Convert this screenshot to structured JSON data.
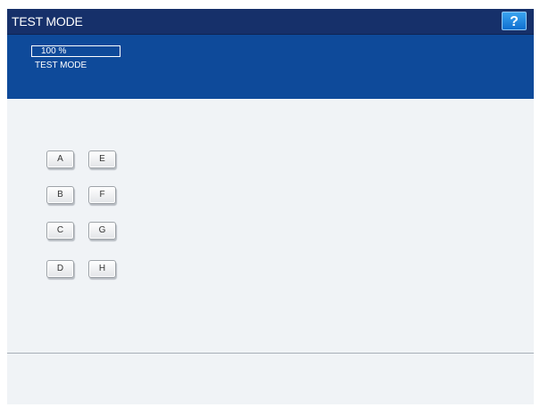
{
  "title_bar": {
    "title": "TEST MODE",
    "help_label": "?"
  },
  "status_panel": {
    "percent": "100 %",
    "mode_text": "TEST MODE"
  },
  "keys": [
    "A",
    "E",
    "B",
    "F",
    "C",
    "G",
    "D",
    "H"
  ],
  "colors": {
    "title_bar": "#16306a",
    "status_panel": "#0e4a9a",
    "help_button": "#1e8ae6",
    "content_background": "#f0f3f6"
  }
}
